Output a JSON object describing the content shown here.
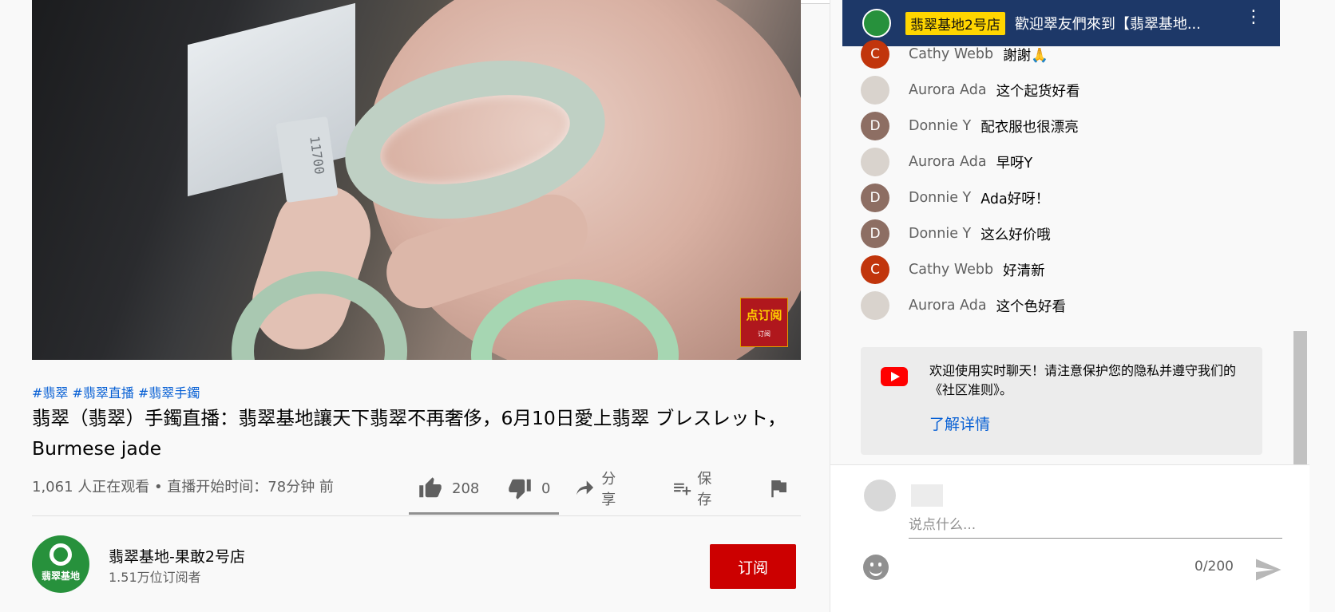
{
  "video": {
    "tag_label": "11700",
    "subscribe_badge": "点订阅",
    "subscribe_badge_small": "订阅"
  },
  "hashtags": [
    "#翡翠",
    "#翡翠直播",
    "#翡翠手鐲"
  ],
  "title": "翡翠（翡翠）手鐲直播：翡翠基地讓天下翡翠不再奢侈，6月10日愛上翡翠 ブレスレット，Burmese jade",
  "viewcount": "1,061 人正在观看 • 直播开始时间：78分钟 前",
  "actions": {
    "likes": "208",
    "dislikes": "0",
    "share": "分享",
    "save": "保存"
  },
  "like_ratio": 1.0,
  "channel": {
    "name": "翡翠基地-果敢2号店",
    "subscribers": "1.51万位订阅者",
    "avatar_text": "翡翠基地",
    "subscribe_label": "订阅"
  },
  "chat": {
    "pinned": {
      "badge": "翡翠基地2号店",
      "text": "歡迎翠友們來到【翡翠基地..."
    },
    "messages": [
      {
        "initial": "C",
        "author": "Cathy Webb",
        "text": "謝謝🙏",
        "color": "#c1350c"
      },
      {
        "initial": "",
        "author": "Aurora Ada",
        "text": "这个起货好看",
        "color": "#d9d3cd"
      },
      {
        "initial": "D",
        "author": "Donnie Y",
        "text": "配衣服也很漂亮",
        "color": "#8d6e63"
      },
      {
        "initial": "",
        "author": "Aurora Ada",
        "text": "早呀Y",
        "color": "#d9d3cd"
      },
      {
        "initial": "D",
        "author": "Donnie Y",
        "text": "Ada好呀！",
        "color": "#8d6e63"
      },
      {
        "initial": "D",
        "author": "Donnie Y",
        "text": "这么好价哦",
        "color": "#8d6e63"
      },
      {
        "initial": "C",
        "author": "Cathy Webb",
        "text": "好清新",
        "color": "#c1350c"
      },
      {
        "initial": "",
        "author": "Aurora Ada",
        "text": "这个色好看",
        "color": "#d9d3cd"
      }
    ],
    "welcome_text": "欢迎使用实时聊天！请注意保护您的隐私并遵守我们的《社区准则》。",
    "welcome_link": "了解详情",
    "input_placeholder": "说点什么...",
    "counter": "0/200"
  },
  "colors": {
    "subscribe": "#cc0000",
    "link": "#065fd4",
    "pinned_bg": "#1d3868",
    "pinned_badge": "#ffd600"
  }
}
